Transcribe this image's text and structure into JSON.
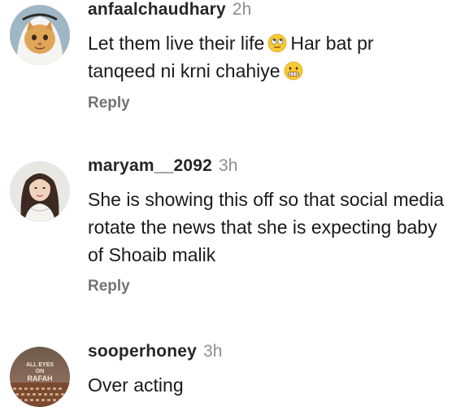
{
  "comments": [
    {
      "username": "anfaalchaudhary",
      "time": "2h",
      "text_part1": "Let them live their life",
      "emoji1": "face-with-rolling-eyes",
      "text_part2": "Har bat pr tanqeed ni krni chahiye",
      "emoji2": "grimacing-face",
      "reply_label": "Reply",
      "avatar": "cat-in-headdress-avatar"
    },
    {
      "username": "maryam__2092",
      "time": "3h",
      "text": "She is showing this off so that social media rotate the news that she is expecting baby of Shoaib malik",
      "reply_label": "Reply",
      "avatar": "woman-portrait-avatar"
    },
    {
      "username": "sooperhoney",
      "time": "3h",
      "text": "Over acting",
      "avatar": "all-eyes-on-rafah-avatar",
      "avatar_text": [
        "ALL EYES",
        "ON",
        "RAFAH"
      ]
    }
  ],
  "colors": {
    "username": "#262626",
    "time": "#8e8e8e",
    "reply": "#737373",
    "emoji_face": "#f7c933"
  }
}
